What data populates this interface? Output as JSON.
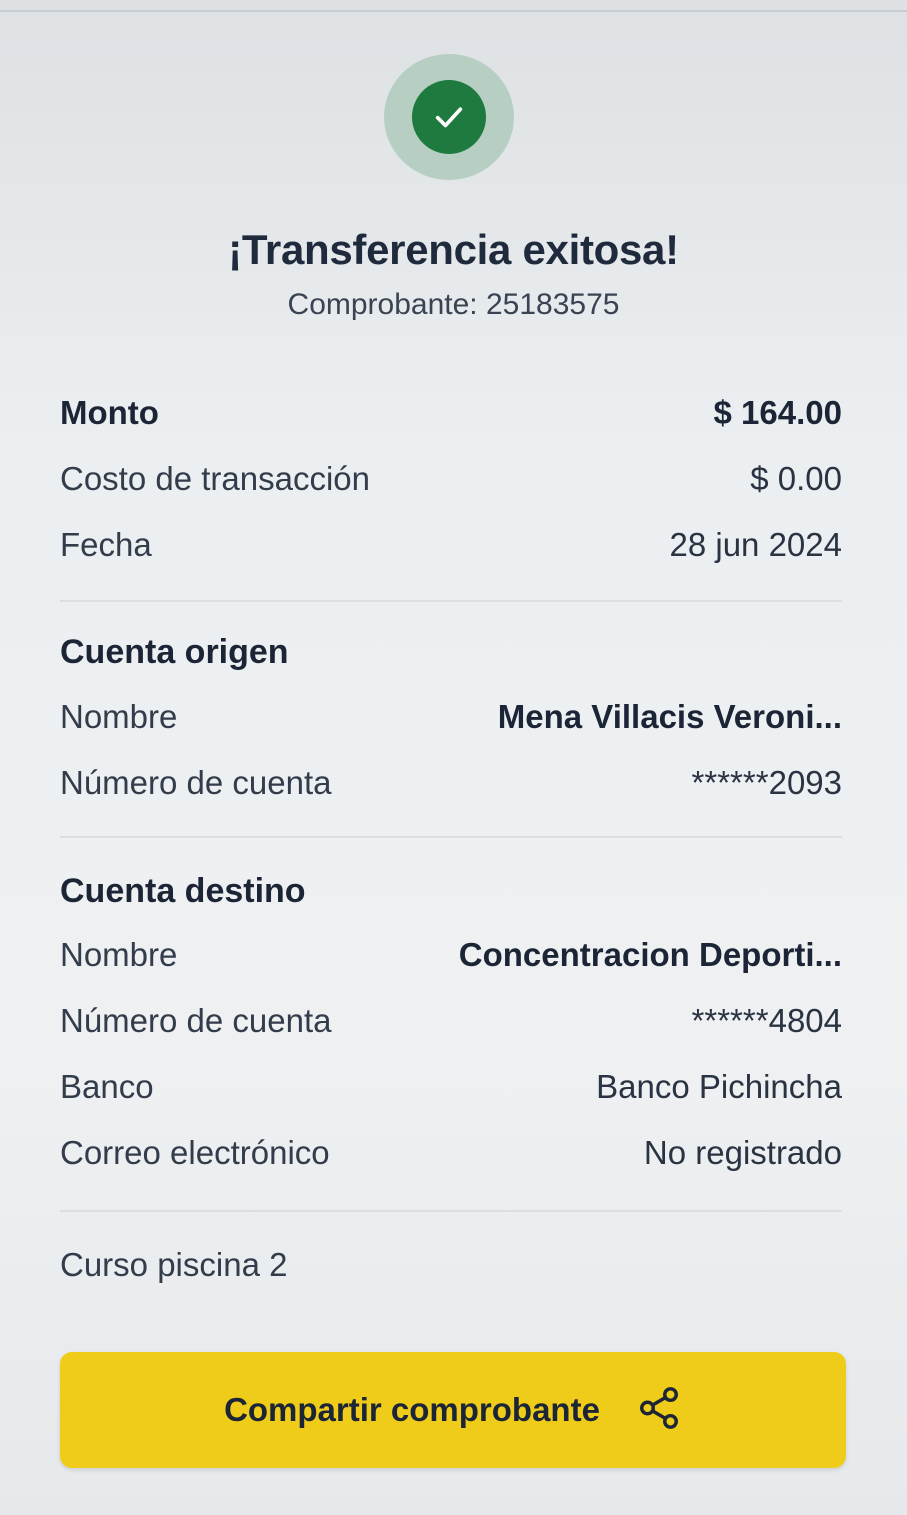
{
  "status": {
    "title": "¡Transferencia exitosa!",
    "receipt": "Comprobante: 25183575",
    "icon": "check-circle-icon",
    "color": "#1e7a3e"
  },
  "summary": {
    "amount_label": "Monto",
    "amount_value": "$ 164.00",
    "fee_label": "Costo de transacción",
    "fee_value": "$ 0.00",
    "date_label": "Fecha",
    "date_value": "28 jun 2024"
  },
  "origin": {
    "title": "Cuenta origen",
    "name_label": "Nombre",
    "name_value": "Mena  Villacis Veroni...",
    "account_label": "Número de cuenta",
    "account_value": "******2093"
  },
  "destination": {
    "title": "Cuenta destino",
    "name_label": "Nombre",
    "name_value": "Concentracion Deporti...",
    "account_label": "Número de cuenta",
    "account_value": "******4804",
    "bank_label": "Banco",
    "bank_value": "Banco Pichincha",
    "email_label": "Correo electrónico",
    "email_value": "No registrado"
  },
  "description": "Curso piscina 2",
  "share_button": {
    "label": "Compartir comprobante",
    "icon": "share-icon",
    "color": "#f0cc1a"
  }
}
